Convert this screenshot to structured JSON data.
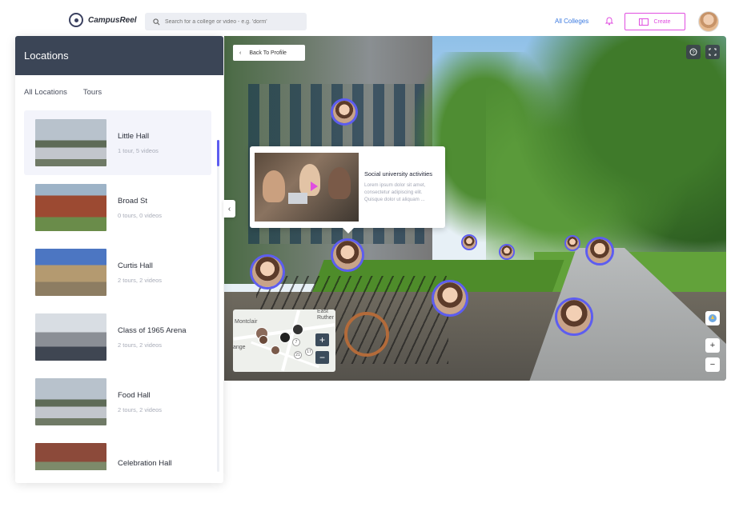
{
  "header": {
    "logo_text": "CampusReel",
    "search_placeholder": "Search for a college or video - e.g. 'dorm'",
    "all_colleges": "All Colleges",
    "create_label": "Create"
  },
  "panel": {
    "title": "Locations",
    "tabs": [
      "All Locations",
      "Tours"
    ],
    "items": [
      {
        "name": "Little Hall",
        "sub": "1 tour, 5 videos"
      },
      {
        "name": "Broad St",
        "sub": "0 tours, 0 videos"
      },
      {
        "name": "Curtis Hall",
        "sub": "2 tours, 2 videos"
      },
      {
        "name": "Class of 1965 Arena",
        "sub": "2 tours, 2 videos"
      },
      {
        "name": "Food Hall",
        "sub": "2 tours, 2 videos"
      },
      {
        "name": "Celebration Hall",
        "sub": ""
      }
    ]
  },
  "viewer": {
    "back_label": "Back To Profile",
    "card": {
      "title": "Social university activities",
      "description": "Lorem ipsum dolor sit amet, consectetur adipiscing elit. Quisque dolor ut aliquam ..."
    },
    "minimap": {
      "labels": [
        "Montclair",
        "East Ruther",
        "ange"
      ],
      "markers": [
        "7",
        "21",
        "17"
      ]
    }
  },
  "colors": {
    "header_bg": "#3b4556",
    "accent": "#5d5df0",
    "create": "#e04de0",
    "link": "#3b7ae0"
  }
}
